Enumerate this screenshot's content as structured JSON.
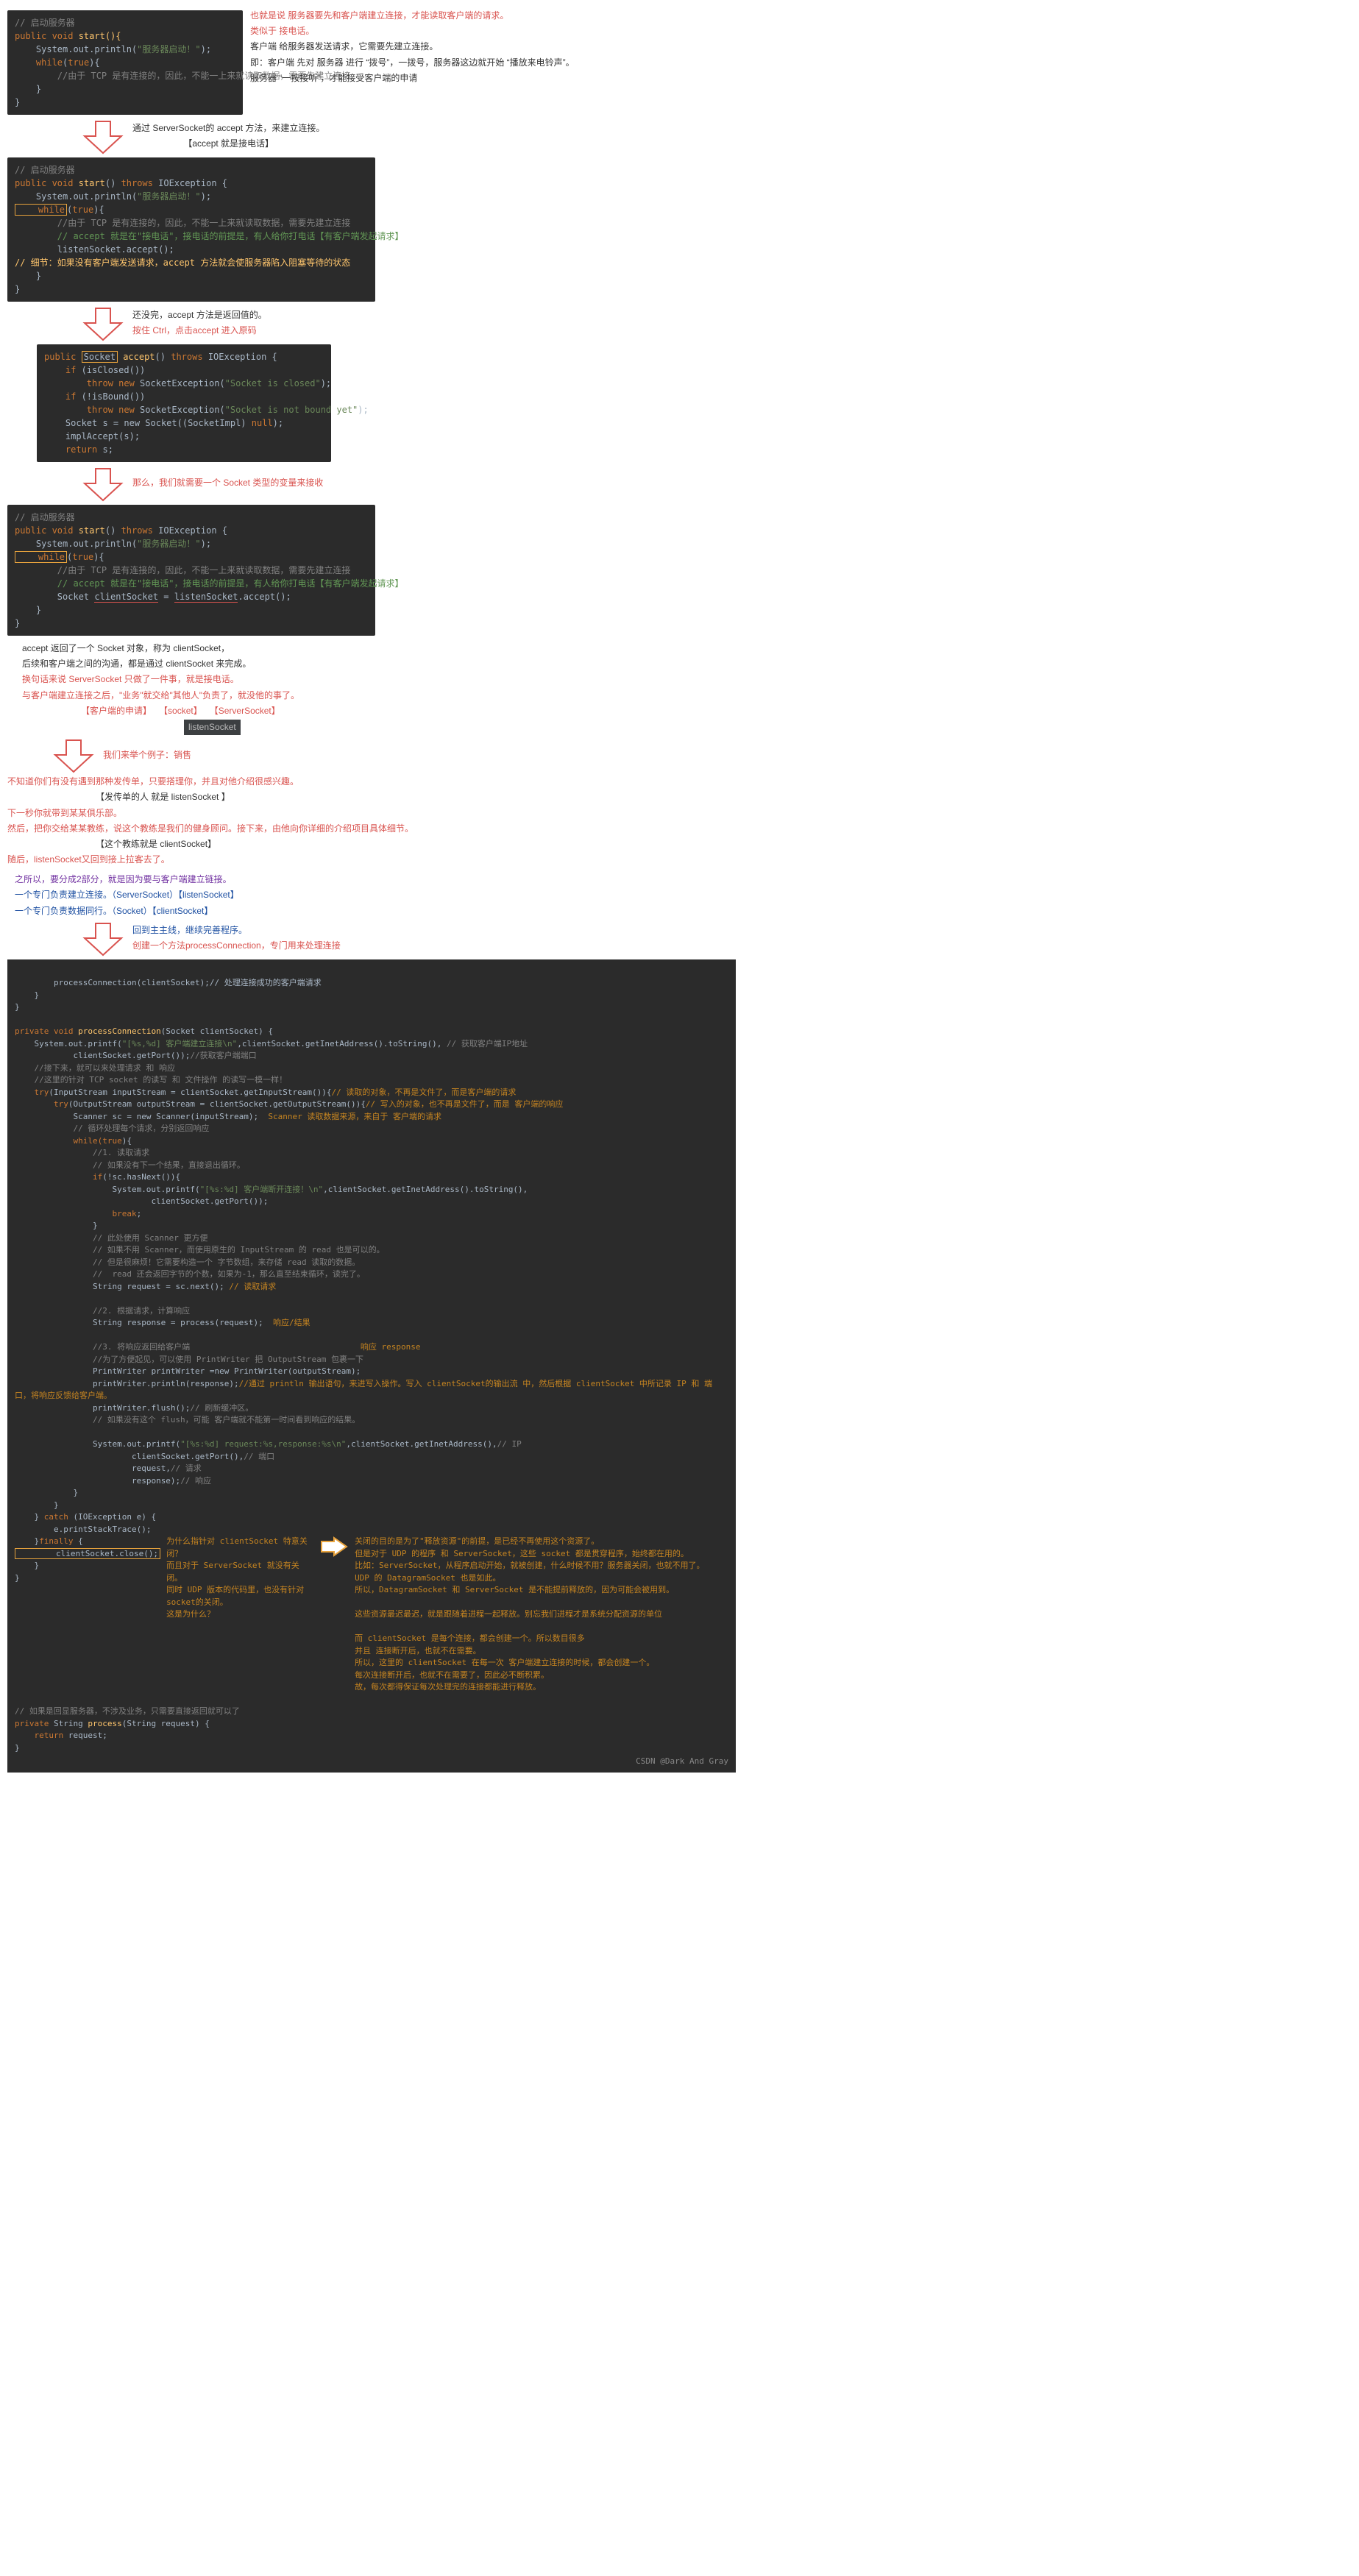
{
  "sec1": {
    "code_cmt1": "// 启动服务器",
    "code_l1a": "public void",
    "code_l1b": " start(){",
    "code_l2a": "    System.out.println(",
    "code_l2b": "\"服务器启动！\"",
    "code_l2c": ");",
    "code_l3a": "    while",
    "code_l3b": "(",
    "code_l3c": "true",
    "code_l3d": "){",
    "code_cmt2": "        //由于 TCP 是有连接的，因此，不能一上来就读取数据，需要先建立连接",
    "code_l4": "    }",
    "code_l5": "}",
    "note_r1": "也就是说 服务器要先和客户端建立连接，才能读取客户端的请求。",
    "note_r2": "类似于 接电话。",
    "note_r3": "客户端 给服务器发送请求，它需要先建立连接。",
    "note_r4": "即：客户端 先对 服务器 进行 “拨号”，一拨号，服务器这边就开始 “播放来电铃声”。",
    "note_r5": "服务器 “一按接听”，才能接受客户端的申请"
  },
  "arrow1_txt_a": "通过 ServerSocket的 accept 方法，来建立连接。",
  "arrow1_txt_b": "【accept 就是接电话】",
  "sec2": {
    "cmt1": "// 启动服务器",
    "l1": "public void start() throws IOException {",
    "l2a": "    System.out.println(",
    "l2b": "\"服务器启动！\"",
    "l2c": ");",
    "l3a": "    while",
    "l3b": "(",
    "l3c": "true",
    "l3d": "){",
    "cmt2": "        //由于 TCP 是有连接的，因此，不能一上来就读取数据，需要先建立连接",
    "cmt3": "        // accept 就是在\"接电话\"，接电话的前提是，有人给你打电话【有客户端发起请求】",
    "l4": "        listenSocket.accept();",
    "cmt4": "// 细节：如果没有客户端发送请求，accept 方法就会使服务器陷入阻塞等待的状态",
    "l5": "    }",
    "l6": "}"
  },
  "sec3_txt1": "还没完，accept 方法是返回值的。",
  "sec3_txt2": "按住 Ctrl，点击accept 进入原码",
  "sec3": {
    "l1a": "public",
    "l1b": "Socket",
    "l1c": "accept() throws IOException {",
    "l2a": "    if (isClosed())",
    "l3a": "        throw new SocketException(",
    "l3b": "\"Socket is closed\"",
    "l3c": ");",
    "l4a": "    if (!isBound())",
    "l5a": "        throw new SocketException(",
    "l5b": "\"Socket is not bound yet\"",
    "l5c": ");",
    "l6a": "    Socket s = new Socket((SocketImpl) ",
    "l6b": "null",
    "l6c": ");",
    "l7": "    implAccept(s);",
    "l8a": "    return",
    "l8b": " s;"
  },
  "sec4_txt": "那么，我们就需要一个 Socket 类型的变量来接收",
  "sec4": {
    "cmt1": "// 启动服务器",
    "l1": "public void start() throws IOException {",
    "l2a": "    System.out.println(",
    "l2b": "\"服务器启动！\"",
    "l2c": ");",
    "l3a": "    while",
    "l3b": "(",
    "l3c": "true",
    "l3d": "){",
    "cmt2": "        //由于 TCP 是有连接的，因此，不能一上来就读取数据，需要先建立连接",
    "cmt3": "        // accept 就是在\"接电话\"，接电话的前提是，有人给你打电话【有客户端发起请求】",
    "l4a": "        Socket ",
    "l4b": "clientSocket",
    "l4c": " = ",
    "l4d": "listenSocket",
    "l4e": ".accept();",
    "l5": "    }",
    "l6": "}"
  },
  "sec5": {
    "p1": "accept 返回了一个 Socket 对象，称为 clientSocket，",
    "p2": "后续和客户端之间的沟通，都是通过 clientSocket 来完成。",
    "p3": "换句话来说 ServerSocket 只做了一件事，就是接电话。",
    "p4": "与客户端建立连接之后，\"业务\"就交给\"其他人\"负责了，就没他的事了。",
    "tag1": "【客户端的申请】",
    "tag2": "【socket】",
    "tag3": "【ServerSocket】",
    "tag4": "listenSocket"
  },
  "sec6_txt": "我们来举个例子：销售",
  "sec6": {
    "p1": "不知道你们有没有遇到那种发传单，只要搭理你，并且对他介绍很感兴趣。",
    "p2": "【发传单的人 就是 listenSocket 】",
    "p3": "下一秒你就带到某某俱乐部。",
    "p4": "然后，把你交给某某教练，说这个教练是我们的健身顾问。接下来，由他向你详细的介绍项目具体细节。",
    "p5": "【这个教练就是 clientSocket】",
    "p6": "随后，listenSocket又回到接上拉客去了。"
  },
  "sec7": {
    "p1": "之所以，要分成2部分，就是因为要与客户端建立链接。",
    "p2": "一个专门负责建立连接。（ServerSocket）【listenSocket】",
    "p3": "一个专门负责数据同行。（Socket）【clientSocket】"
  },
  "sec8_txt1": "回到主主线，继续完善程序。",
  "sec8_txt2": "创建一个方法processConnection，专门用来处理连接",
  "bigcode": {
    "l1": "        processConnection(clientSocket);// 处理连接成功的客户端请求",
    "l2": "    }",
    "l3": "}",
    "l4": "",
    "l5": "private void processConnection(Socket clientSocket) {",
    "l6a": "    System.out.printf(",
    "l6b": "\"[%s,%d] 客户端建立连接\\n\"",
    "l6c": ",clientSocket.getInetAddress().toString(),",
    "l6d": "// 获取客户端IP地址",
    "l7a": "            clientSocket.getPort());",
    "l7b": "//获取客户端端口",
    "l8": "    //接下来，就可以来处理请求 和 响应",
    "l9": "    //这里的针对 TCP socket 的读写 和 文件操作 的读写一模一样！",
    "l10a": "    try(InputStream inputStream = clientSocket.getInputStream()){",
    "l10b": "// 读取的对象，不再是文件了，而是客户端的请求",
    "l11a": "        try(OutputStream outputStream = clientSocket.getOutputStream()){",
    "l11b": "// 写入的对象，也不再是文件了，而是 客户端的响应",
    "l12a": "            Scanner sc = new Scanner(inputStream);",
    "l12b": "  Scanner 读取数据来源，来自于 客户端的请求",
    "l13": "            // 循环处理每个请求，分别返回响应",
    "l14a": "            while(",
    "l14b": "true",
    "l14c": "){",
    "l15": "                //1. 读取请求",
    "l16": "                // 如果没有下一个结果，直接退出循环。",
    "l17": "                if(!sc.hasNext()){",
    "l18a": "                    System.out.printf(",
    "l18b": "\"[%s:%d] 客户端断开连接！\\n\"",
    "l18c": ",clientSocket.getInetAddress().toString(),",
    "l19": "                            clientSocket.getPort());",
    "l20a": "                    break",
    "l20b": ";",
    "l21": "                }",
    "l22": "                // 此处使用 Scanner 更方便",
    "l23": "                // 如果不用 Scanner，而使用原生的 InputStream 的 read 也是可以的。",
    "l24": "                // 但是很麻烦！它需要构造一个 字节数组，来存储 read 读取的数据。",
    "l25": "                //  read 还会返回字节的个数，如果为-1，那么直至结束循环，读完了。",
    "l26a": "                String request = sc.next();",
    "l26b": "// 读取请求",
    "l27": "",
    "l28": "                //2. 根据请求，计算响应",
    "l29a": "                String response = process(request);",
    "l29b": "  响应/结果",
    "l30": "",
    "l31a": "                //3. 将响应返回给客户端                                   ",
    "l31b": "响应 response",
    "l32": "                //为了方便起见，可以使用 PrintWriter 把 OutputStream 包裹一下",
    "l33": "                PrintWriter printWriter =new PrintWriter(outputStream);",
    "l34a": "                printWriter.println(response);",
    "l34b": "//通过 println 输出语句，来进写入操作。写入 clientSocket的输出流 中，然后根据 clientSocket 中所记录 IP 和 端口，将响应反馈给客户端。",
    "l35a": "                printWriter.flush();",
    "l35b": "// 刷新缓冲区。",
    "l36": "                // 如果没有这个 flush，可能 客户端就不能第一时间看到响应的结果。",
    "l37": "",
    "l38a": "                System.out.printf(",
    "l38b": "\"[%s:%d] request:%s,response:%s\\n\"",
    "l38c": ",clientSocket.getInetAddress(),",
    "l38d": "// IP",
    "l39a": "                        clientSocket.getPort(),",
    "l39b": "// 端口",
    "l40a": "                        request,",
    "l40b": "// 请求",
    "l41a": "                        response);",
    "l41b": "// 响应",
    "l42": "            }",
    "l43": "        }",
    "l44a": "    } catch (IOException e) {",
    "l45": "        e.printStackTrace();",
    "l46a": "    }finally {",
    "l47a": "        clientSocket.close();",
    "l48": "    }",
    "l49": "}",
    "l50": "// 如果是回显服务器，不涉及业务，只需要直接返回就可以了",
    "l51": "private String process(String request) {",
    "l52a": "    return",
    "l52b": " request;",
    "l53": "}",
    "box_left_l1": "为什么指针对 clientSocket 特意关闭？",
    "box_left_l2": "而且对于 ServerSocket 就没有关闭。",
    "box_left_l3": "同时 UDP 版本的代码里，也没有针对 socket的关闭。",
    "box_left_l4": "这是为什么？",
    "box_right_l1": "关闭的目的是为了\"释放资源\"的前提，是已经不再使用这个资源了。",
    "box_right_l2": "但是对于 UDP 的程序 和 ServerSocket，这些 socket 都是贯穿程序，始终都在用的。",
    "box_right_l3": "比如：ServerSocket，从程序启动开始，就被创建，什么时候不用？服务器关闭，也就不用了。",
    "box_right_l4": "       UDP 的 DatagramSocket 也是如此。",
    "box_right_l5": "所以，DatagramSocket 和 ServerSocket 是不能提前释放的，因为可能会被用到。",
    "box_right_l6": "这些资源最迟最迟，就是跟随着进程一起释放。别忘我们进程才是系统分配资源的单位",
    "box_right_l7": "",
    "box_right_l8": "而 clientSocket 是每个连接，都会创建一个。所以数目很多",
    "box_right_l9": "并且 连接断开后，也就不在需要。",
    "box_right_l10": "所以，这里的 clientSocket 在每一次 客户端建立连接的时候，都会创建一个。",
    "box_right_l11": "每次连接断开后，也就不在需要了，因此必不断积累。",
    "box_right_l12": "故，每次都得保证每次处理完的连接都能进行释放。",
    "watermark": "CSDN @Dark And Gray"
  }
}
